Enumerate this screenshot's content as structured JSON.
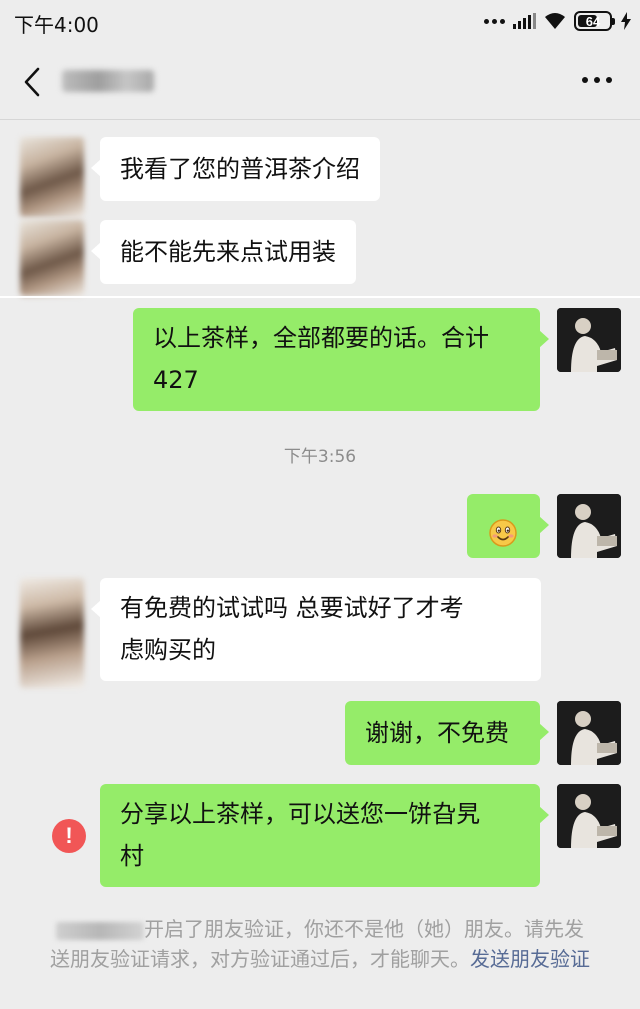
{
  "status_bar": {
    "time": "下午4:00",
    "battery": "64",
    "battery_level": 0.64
  },
  "header": {
    "contact_name": "",
    "back_icon": "chevron-left-icon",
    "more_icon": "more-horizontal-icon"
  },
  "messages": [
    {
      "side": "left",
      "text": "我看了您的普洱茶介绍"
    },
    {
      "side": "left",
      "text": "能不能先来点试用装"
    },
    {
      "side": "right",
      "text": "以上茶样，全部都要的话。合计"
    },
    {
      "side": "right",
      "text": "427"
    },
    {
      "side": "right",
      "text": "",
      "emoji": "smiling-face-emoji"
    },
    {
      "side": "left",
      "text": "有免费的试试吗 总要试好了才考"
    },
    {
      "side": "left",
      "text": "虑购买的"
    },
    {
      "side": "right",
      "text": "谢谢，不免费"
    },
    {
      "side": "right",
      "text": "分享以上茶样，可以送您一饼旮旯"
    },
    {
      "side": "right",
      "text": "村"
    }
  ],
  "timestamp": "下午3:56",
  "error_mark": "!",
  "system_note": {
    "text": "开启了朋友验证，你还不是他（她）朋友。请先发送朋友验证请求，对方验证通过后，才能聊天。",
    "link": "发送朋友验证"
  },
  "colors": {
    "background": "#ededed",
    "bubble_self": "#95ec69",
    "bubble_other": "#ffffff",
    "link": "#576b95",
    "error": "#f15656"
  }
}
